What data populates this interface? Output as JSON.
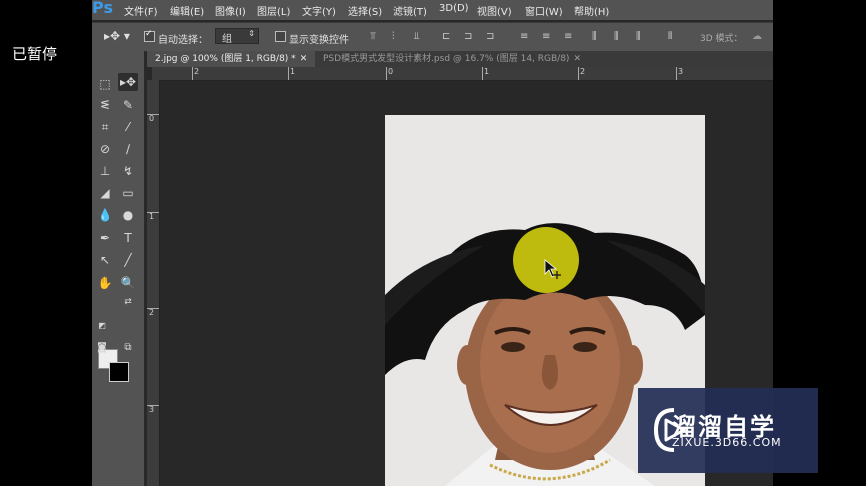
{
  "overlay": {
    "paused_label": "已暂停"
  },
  "app": {
    "logo": "Ps",
    "menu": [
      "文件(F)",
      "编辑(E)",
      "图像(I)",
      "图层(L)",
      "文字(Y)",
      "选择(S)",
      "滤镜(T)",
      "3D(D)",
      "视图(V)",
      "窗口(W)",
      "帮助(H)"
    ]
  },
  "options": {
    "auto_select_label": "自动选择：",
    "auto_select_checked": true,
    "auto_select_value": "组",
    "show_transform_label": "显示变换控件",
    "show_transform_checked": false,
    "mode_label": "3D 模式："
  },
  "tabs": [
    {
      "label": "2.jpg @ 100% (图层 1, RGB/8) *",
      "active": true
    },
    {
      "label": "PSD模式男式发型设计素材.psd @ 16.7% (图层 14, RGB/8)",
      "active": false
    }
  ],
  "ruler": {
    "h": [
      "2",
      "1",
      "0",
      "1",
      "2",
      "3"
    ],
    "v": [
      "0",
      "1",
      "2",
      "3"
    ]
  },
  "watermark": {
    "title": "溜溜自学",
    "subtitle": "ZIXUE.3D66.COM"
  },
  "colors": {
    "accent_ps": "#3d9ae8",
    "cursor_highlight": "#c9c50f",
    "watermark_bg": "#242e56"
  }
}
